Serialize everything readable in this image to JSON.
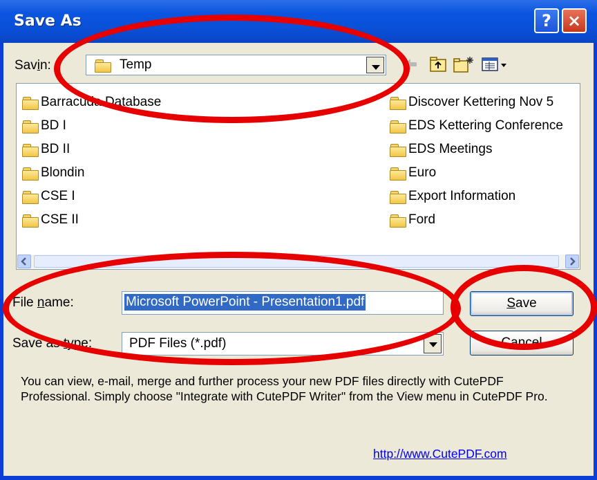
{
  "window": {
    "title": "Save As",
    "help_glyph": "?",
    "close_glyph": "×"
  },
  "save_in": {
    "label_pre": "Sav",
    "label_underlined": "i",
    "label_post": "n:",
    "value": "Temp"
  },
  "toolbar": {
    "icons": [
      "back-arrow-icon",
      "up-folder-icon",
      "new-folder-icon",
      "view-menu-icon"
    ]
  },
  "files": {
    "left_column": [
      "Barracuda Database",
      "BD I",
      "BD II",
      "Blondin",
      "CSE I",
      "CSE II"
    ],
    "right_column": [
      "Discover Kettering Nov 5",
      "EDS Kettering Conference",
      "EDS Meetings",
      "Euro",
      "Export Information",
      "Ford"
    ]
  },
  "file_name": {
    "label_pre": "File ",
    "label_underlined": "n",
    "label_post": "ame:",
    "value": "Microsoft PowerPoint - Presentation1.pdf"
  },
  "save_as_type": {
    "label_pre": "Save as ",
    "label_underlined": "t",
    "label_post": "ype:",
    "value": "PDF Files (*.pdf)"
  },
  "buttons": {
    "save_underlined": "S",
    "save_rest": "ave",
    "cancel": "Cancel"
  },
  "info": {
    "text": "You can view, e-mail, merge and further process your new PDF files directly with CutePDF Professional. Simply choose \"Integrate with CutePDF Writer\" from the View menu in CutePDF Pro.",
    "link": "http://www.CutePDF.com"
  },
  "colors": {
    "annotation_ring": "#e60000",
    "title_bar": "#0a4fd6",
    "selection": "#316ac5"
  }
}
